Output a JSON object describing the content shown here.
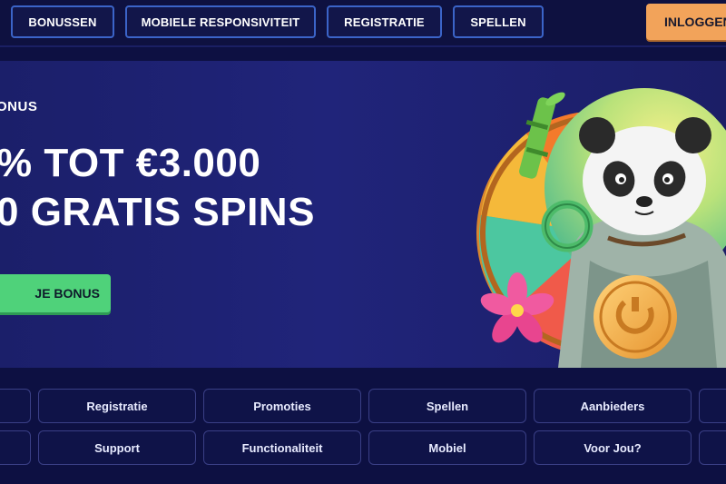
{
  "nav": {
    "items": [
      "BONUSSEN",
      "MOBIELE RESPONSIVITEIT",
      "REGISTRATIE",
      "SPELLEN"
    ],
    "login_label": "INLOGGEN"
  },
  "hero": {
    "label": "ONUS",
    "line1": "% TOT €3.000",
    "line2": "0 GRATIS SPINS",
    "cta_label": "JE BONUS"
  },
  "menu": {
    "row1": [
      "Registratie",
      "Promoties",
      "Spellen",
      "Aanbieders"
    ],
    "row2": [
      "Support",
      "Functionaliteit",
      "Mobiel",
      "Voor Jou?"
    ]
  },
  "colors": {
    "page_bg": "#0d1042",
    "hero_bg": "#20247a",
    "nav_border": "#3b64c8",
    "login_bg": "#f2a35a",
    "cta_bg": "#4fd27a"
  }
}
